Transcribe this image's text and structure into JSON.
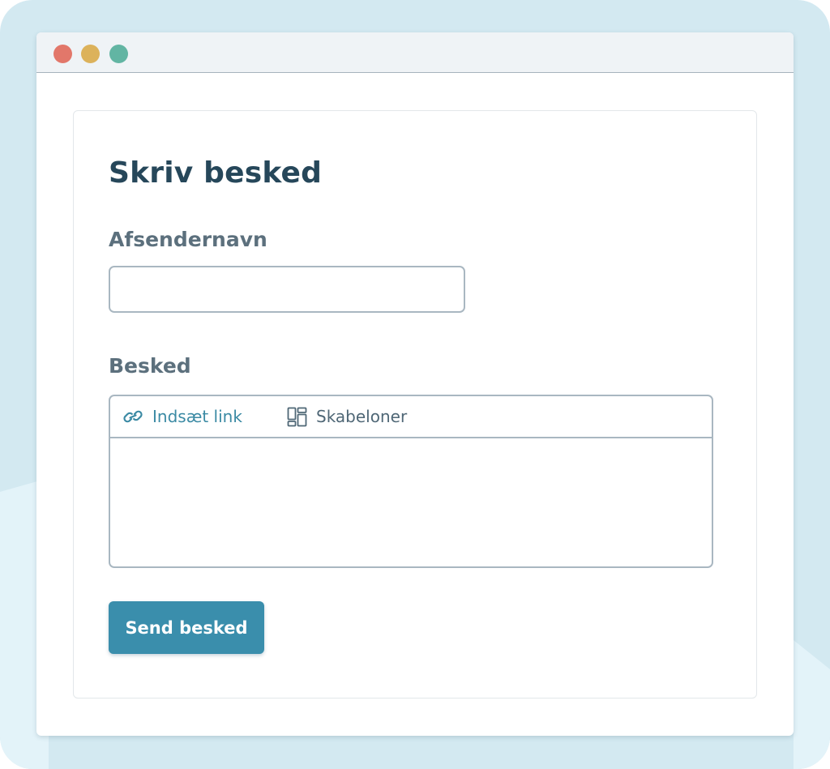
{
  "colors": {
    "background": "#d3e9f1",
    "background_wave": "#e3f3f9",
    "titlebar": "#eff3f6",
    "dot_close": "#e2776a",
    "dot_minimize": "#dcb25b",
    "dot_maximize": "#62b5a3",
    "heading": "#26475a",
    "label": "#5c707d",
    "accent": "#3b8aa4",
    "button": "#3a8eac",
    "border": "#a9b7c1"
  },
  "window": {
    "controls": [
      "close-dot",
      "minimize-dot",
      "maximize-dot"
    ]
  },
  "form": {
    "title": "Skriv besked",
    "sender_label": "Afsendernavn",
    "sender_value": "",
    "message_label": "Besked",
    "message_value": "",
    "toolbar": {
      "insert_link": "Indsæt link",
      "insert_link_icon": "link-icon",
      "templates": "Skabeloner",
      "templates_icon": "template-layout-icon"
    },
    "submit_label": "Send besked"
  }
}
